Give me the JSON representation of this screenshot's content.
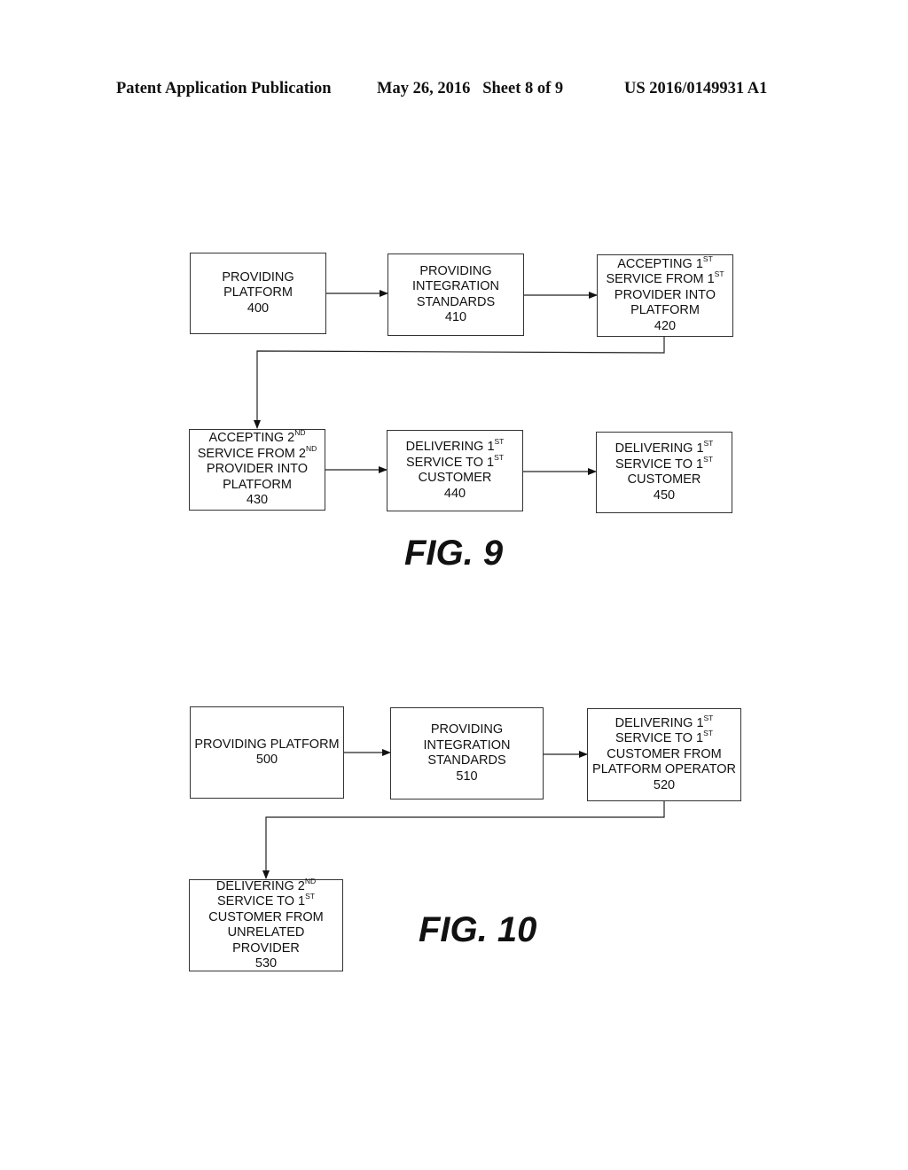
{
  "header": {
    "left": "Patent Application Publication",
    "middle": "May 26, 2016   Sheet 8 of 9",
    "right": "US 2016/0149931 A1"
  },
  "fig9": {
    "label": "FIG. 9",
    "boxes": [
      {
        "id": "400",
        "lines": [
          [
            "PROVIDING"
          ],
          [
            "PLATFORM"
          ],
          [
            "400"
          ]
        ]
      },
      {
        "id": "410",
        "lines": [
          [
            "PROVIDING"
          ],
          [
            "INTEGRATION"
          ],
          [
            "STANDARDS"
          ],
          [
            "410"
          ]
        ]
      },
      {
        "id": "420",
        "lines": [
          [
            "ACCEPTING 1",
            "ST"
          ],
          [
            "SERVICE FROM 1",
            "ST"
          ],
          [
            "PROVIDER INTO"
          ],
          [
            "PLATFORM"
          ],
          [
            "420"
          ]
        ]
      },
      {
        "id": "430",
        "lines": [
          [
            "ACCEPTING 2",
            "ND"
          ],
          [
            "SERVICE FROM 2",
            "ND"
          ],
          [
            "PROVIDER INTO"
          ],
          [
            "PLATFORM"
          ],
          [
            "430"
          ]
        ]
      },
      {
        "id": "440",
        "lines": [
          [
            "DELIVERING 1",
            "ST"
          ],
          [
            "SERVICE TO 1",
            "ST"
          ],
          [
            "CUSTOMER"
          ],
          [
            "440"
          ]
        ]
      },
      {
        "id": "450",
        "lines": [
          [
            "DELIVERING 1",
            "ST"
          ],
          [
            "SERVICE TO 1",
            "ST"
          ],
          [
            "CUSTOMER"
          ],
          [
            "450"
          ]
        ]
      }
    ]
  },
  "fig10": {
    "label": "FIG. 10",
    "boxes": [
      {
        "id": "500",
        "lines": [
          [
            "PROVIDING PLATFORM"
          ],
          [
            "500"
          ]
        ]
      },
      {
        "id": "510",
        "lines": [
          [
            "PROVIDING"
          ],
          [
            "INTEGRATION"
          ],
          [
            "STANDARDS"
          ],
          [
            "510"
          ]
        ]
      },
      {
        "id": "520",
        "lines": [
          [
            "DELIVERING 1",
            "ST"
          ],
          [
            "SERVICE TO 1",
            "ST"
          ],
          [
            "CUSTOMER FROM"
          ],
          [
            "PLATFORM OPERATOR"
          ],
          [
            "520"
          ]
        ]
      },
      {
        "id": "530",
        "lines": [
          [
            "DELIVERING 2",
            "ND"
          ],
          [
            "SERVICE TO 1",
            "ST"
          ],
          [
            "CUSTOMER FROM"
          ],
          [
            "UNRELATED"
          ],
          [
            "PROVIDER"
          ],
          [
            "530"
          ]
        ]
      }
    ]
  },
  "colors": {
    "ink": "#111111",
    "background": "#ffffff"
  }
}
